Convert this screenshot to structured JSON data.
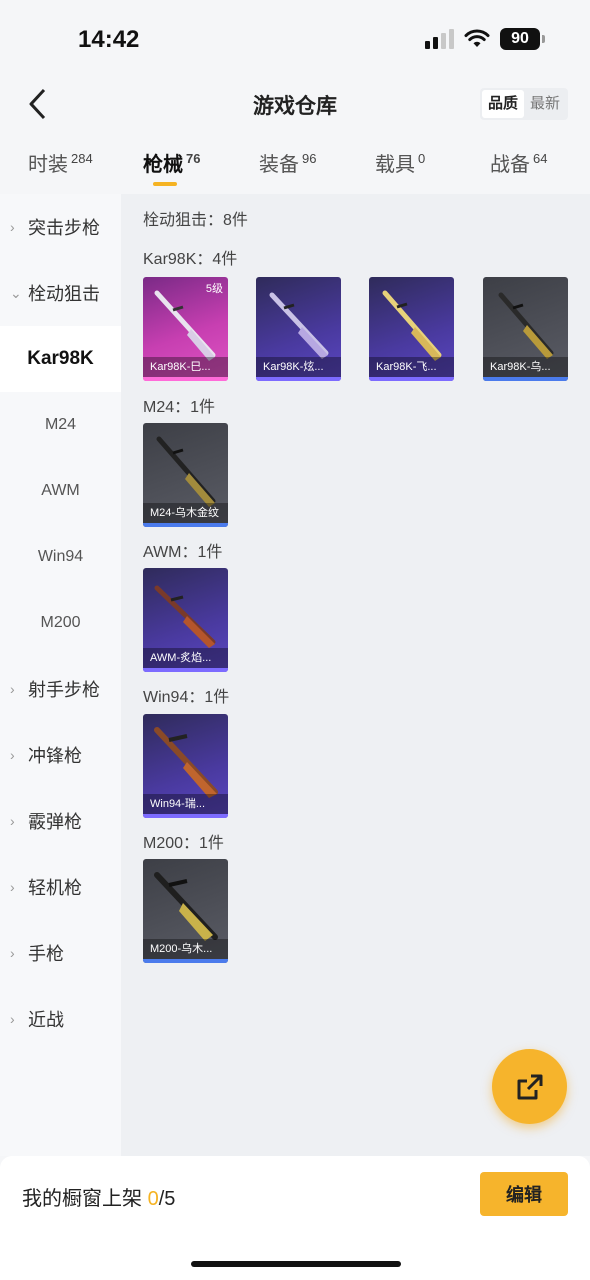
{
  "status": {
    "time": "14:42",
    "battery": "90"
  },
  "nav": {
    "title": "游戏仓库",
    "sort_quality": "品质",
    "sort_latest": "最新"
  },
  "tabs": [
    {
      "label": "时装",
      "count": "284"
    },
    {
      "label": "枪械",
      "count": "76"
    },
    {
      "label": "装备",
      "count": "96"
    },
    {
      "label": "载具",
      "count": "0"
    },
    {
      "label": "战备",
      "count": "64"
    }
  ],
  "sidebar": {
    "items": [
      {
        "label": "突击步枪"
      },
      {
        "label": "栓动狙击"
      },
      {
        "label": "Kar98K"
      },
      {
        "label": "M24"
      },
      {
        "label": "AWM"
      },
      {
        "label": "Win94"
      },
      {
        "label": "M200"
      },
      {
        "label": "射手步枪"
      },
      {
        "label": "冲锋枪"
      },
      {
        "label": "霰弹枪"
      },
      {
        "label": "轻机枪"
      },
      {
        "label": "手枪"
      },
      {
        "label": "近战"
      }
    ]
  },
  "content": {
    "summary": "栓动狙击：8件",
    "groups": [
      {
        "title": "Kar98K：4件",
        "items": [
          {
            "name": "Kar98K-巳...",
            "level": "5级",
            "quality": "pink"
          },
          {
            "name": "Kar98K-炫...",
            "quality": "purple"
          },
          {
            "name": "Kar98K-飞...",
            "quality": "purple"
          },
          {
            "name": "Kar98K-乌...",
            "quality": "gray"
          }
        ]
      },
      {
        "title": "M24：1件",
        "items": [
          {
            "name": "M24-乌木金纹",
            "quality": "gray"
          }
        ]
      },
      {
        "title": "AWM：1件",
        "items": [
          {
            "name": "AWM-炙焰...",
            "quality": "purple"
          }
        ]
      },
      {
        "title": "Win94：1件",
        "items": [
          {
            "name": "Win94-瑞...",
            "quality": "purple"
          }
        ]
      },
      {
        "title": "M200：1件",
        "items": [
          {
            "name": "M200-乌木...",
            "quality": "gray"
          }
        ]
      }
    ]
  },
  "bottom": {
    "showcase_label": "我的橱窗上架",
    "showcase_current": "0",
    "showcase_total": "/5",
    "edit_label": "编辑"
  },
  "colors": {
    "accent": "#f6b42c",
    "pink_quality": "#ff6bd9",
    "purple_quality": "#7d6bff",
    "gray_quality": "#4b7bec"
  }
}
